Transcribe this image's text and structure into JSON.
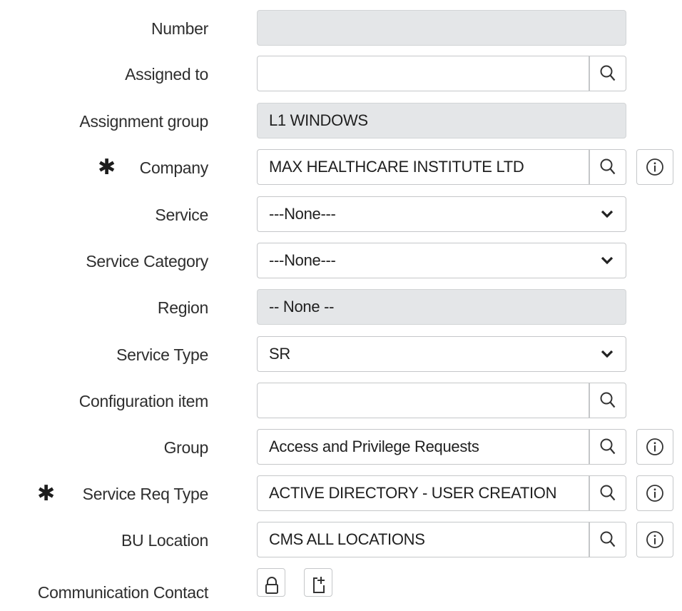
{
  "form": {
    "number": {
      "label": "Number",
      "value": ""
    },
    "assigned_to": {
      "label": "Assigned to",
      "value": ""
    },
    "assignment_group": {
      "label": "Assignment group",
      "value": "L1 WINDOWS"
    },
    "company": {
      "label": "Company",
      "value": "MAX HEALTHCARE INSTITUTE LTD"
    },
    "service": {
      "label": "Service",
      "value": "---None---"
    },
    "service_category": {
      "label": "Service Category",
      "value": "---None---"
    },
    "region": {
      "label": "Region",
      "value": "-- None --"
    },
    "service_type": {
      "label": "Service Type",
      "value": "SR"
    },
    "configuration_item": {
      "label": "Configuration item",
      "value": ""
    },
    "group": {
      "label": "Group",
      "value": "Access and Privilege Requests"
    },
    "service_req_type": {
      "label": "Service Req Type",
      "value": "ACTIVE DIRECTORY - USER CREATION"
    },
    "bu_location": {
      "label": "BU Location",
      "value": "CMS ALL LOCATIONS"
    },
    "communication_contact": {
      "label": "Communication Contact"
    }
  },
  "icons": {
    "mandatory": "asterisk-icon",
    "lookup": "search-icon",
    "info": "info-icon",
    "dropdown": "chevron-down-icon",
    "lock": "lock-icon",
    "add": "add-icon"
  },
  "colors": {
    "readonly_bg": "#e4e6e8",
    "border": "#c5c7c9",
    "text": "#2e2e2e"
  }
}
